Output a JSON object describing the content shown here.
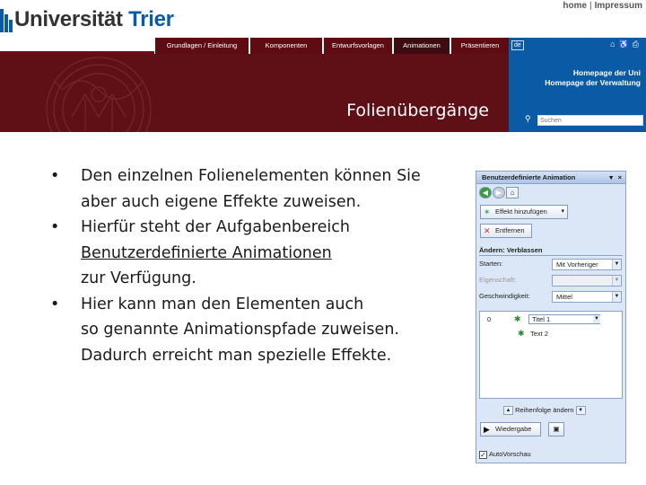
{
  "header": {
    "logo_part1": "Universität",
    "logo_part2": "Trier",
    "links": [
      "home",
      "Impressum"
    ],
    "link_separator": "|"
  },
  "nav": {
    "tabs": [
      {
        "label": "Grundlagen / Einleitung",
        "active": false
      },
      {
        "label": "Komponenten",
        "active": false
      },
      {
        "label": "Entwurfsvorlagen",
        "active": false
      },
      {
        "label": "Animationen",
        "active": true
      },
      {
        "label": "Präsentieren",
        "active": false
      }
    ]
  },
  "slide": {
    "title": "Folienübergänge",
    "bullets": [
      {
        "lines": [
          "Den einzelnen Folienelementen können Sie",
          "aber auch eigene Effekte zuweisen."
        ]
      },
      {
        "lines": [
          "Hierfür steht der Aufgabenbereich",
          "Benutzerdefinierte Animationen",
          "zur Verfügung."
        ],
        "underlined_line": 1
      },
      {
        "lines": [
          "Hier kann man den Elementen auch",
          "so genannte Animationspfade zuweisen.",
          "Dadurch erreicht man spezielle Effekte."
        ]
      }
    ]
  },
  "right_panel": {
    "language": "de",
    "links": [
      "Homepage der Uni",
      "Homepage der Verwaltung"
    ],
    "search_placeholder": "Suchen",
    "icons": [
      "sitemap-icon",
      "accessibility-icon",
      "print-icon"
    ]
  },
  "task_pane": {
    "title": "Benutzerdefinierte Animation",
    "add_effect_label": "Effekt hinzufügen",
    "remove_label": "Entfernen",
    "section_label": "Ändern: Verblassen",
    "start_label": "Starten:",
    "start_value": "Mit Vorheriger",
    "property_label": "Eigenschaft:",
    "property_value": "",
    "speed_label": "Geschwindigkeit:",
    "speed_value": "Mittel",
    "animations": [
      {
        "number": "0",
        "label": "Titel 1"
      },
      {
        "number": "",
        "label": "Text 2"
      }
    ],
    "reorder_label": "Reihenfolge ändern",
    "play_label": "Wiedergabe",
    "autopreview_label": "AutoVorschau",
    "autopreview_checked": true
  },
  "colors": {
    "university_red": "#5f0f16",
    "university_blue": "#0a5aa6",
    "pane_bg": "#dbe6f6"
  }
}
